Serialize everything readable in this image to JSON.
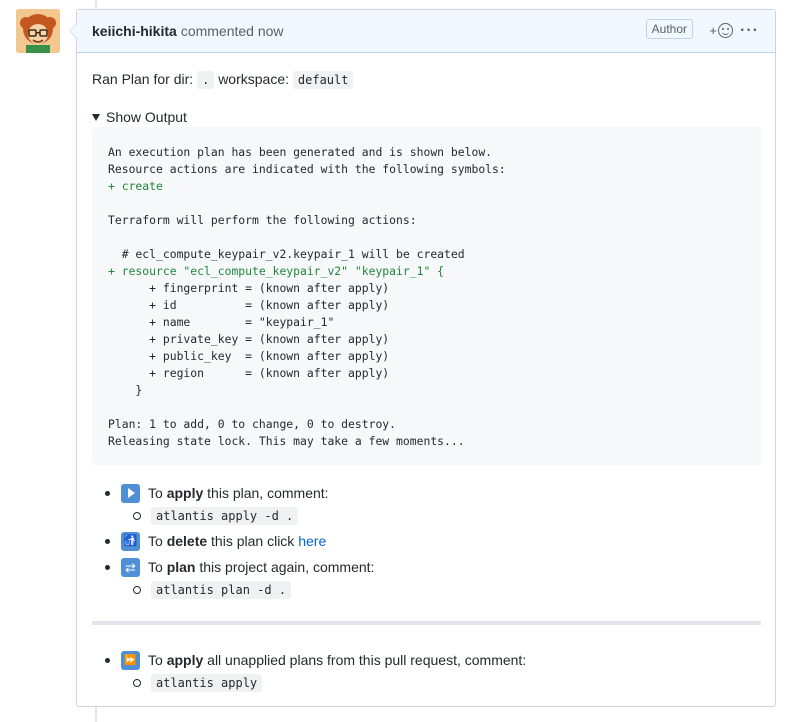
{
  "comment": {
    "author": "keiichi-hikita",
    "header_text": "commented now",
    "author_badge": "Author",
    "reaction_plus": "+",
    "more_label": "···"
  },
  "plan_line": {
    "prefix": "Ran Plan for dir:",
    "dir": ".",
    "workspace_label": "workspace:",
    "workspace": "default"
  },
  "details": {
    "summary": "Show Output",
    "output_lines": [
      {
        "text": "An execution plan has been generated and is shown below.",
        "green": false
      },
      {
        "text": "Resource actions are indicated with the following symbols:",
        "green": false
      },
      {
        "text": "+ create",
        "green": true
      },
      {
        "text": "",
        "green": false
      },
      {
        "text": "Terraform will perform the following actions:",
        "green": false
      },
      {
        "text": "",
        "green": false
      },
      {
        "text": "  # ecl_compute_keypair_v2.keypair_1 will be created",
        "green": false
      },
      {
        "text": "+ resource \"ecl_compute_keypair_v2\" \"keypair_1\" {",
        "green": true
      },
      {
        "text": "      + fingerprint = (known after apply)",
        "green": false
      },
      {
        "text": "      + id          = (known after apply)",
        "green": false
      },
      {
        "text": "      + name        = \"keypair_1\"",
        "green": false
      },
      {
        "text": "      + private_key = (known after apply)",
        "green": false
      },
      {
        "text": "      + public_key  = (known after apply)",
        "green": false
      },
      {
        "text": "      + region      = (known after apply)",
        "green": false
      },
      {
        "text": "    }",
        "green": false
      },
      {
        "text": "",
        "green": false
      },
      {
        "text": "Plan: 1 to add, 0 to change, 0 to destroy.",
        "green": false
      },
      {
        "text": "Releasing state lock. This may take a few moments...",
        "green": false
      }
    ]
  },
  "actions": {
    "apply": {
      "pre": "To",
      "bold": "apply",
      "post": "this plan, comment:",
      "command": "atlantis apply -d ."
    },
    "delete": {
      "pre": "To",
      "bold": "delete",
      "post": "this plan click",
      "link": "here"
    },
    "plan": {
      "pre": "To",
      "bold": "plan",
      "post": "this project again, comment:",
      "command": "atlantis plan -d ."
    }
  },
  "apply_all": {
    "pre": "To",
    "bold": "apply",
    "post": "all unapplied plans from this pull request, comment:",
    "command": "atlantis apply"
  }
}
